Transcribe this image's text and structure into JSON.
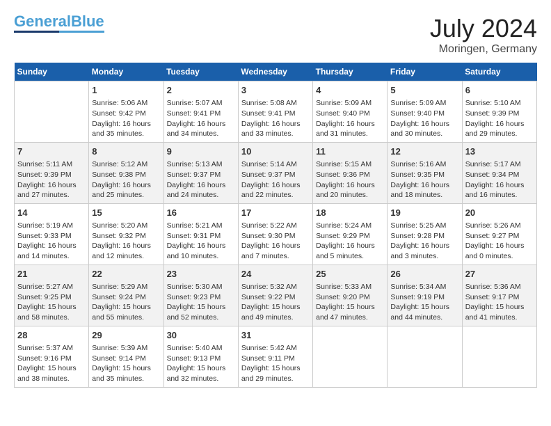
{
  "header": {
    "logo_line1": "General",
    "logo_line2": "Blue",
    "month_year": "July 2024",
    "location": "Moringen, Germany"
  },
  "days_of_week": [
    "Sunday",
    "Monday",
    "Tuesday",
    "Wednesday",
    "Thursday",
    "Friday",
    "Saturday"
  ],
  "weeks": [
    [
      {
        "day": "",
        "info": ""
      },
      {
        "day": "1",
        "info": "Sunrise: 5:06 AM\nSunset: 9:42 PM\nDaylight: 16 hours\nand 35 minutes."
      },
      {
        "day": "2",
        "info": "Sunrise: 5:07 AM\nSunset: 9:41 PM\nDaylight: 16 hours\nand 34 minutes."
      },
      {
        "day": "3",
        "info": "Sunrise: 5:08 AM\nSunset: 9:41 PM\nDaylight: 16 hours\nand 33 minutes."
      },
      {
        "day": "4",
        "info": "Sunrise: 5:09 AM\nSunset: 9:40 PM\nDaylight: 16 hours\nand 31 minutes."
      },
      {
        "day": "5",
        "info": "Sunrise: 5:09 AM\nSunset: 9:40 PM\nDaylight: 16 hours\nand 30 minutes."
      },
      {
        "day": "6",
        "info": "Sunrise: 5:10 AM\nSunset: 9:39 PM\nDaylight: 16 hours\nand 29 minutes."
      }
    ],
    [
      {
        "day": "7",
        "info": "Sunrise: 5:11 AM\nSunset: 9:39 PM\nDaylight: 16 hours\nand 27 minutes."
      },
      {
        "day": "8",
        "info": "Sunrise: 5:12 AM\nSunset: 9:38 PM\nDaylight: 16 hours\nand 25 minutes."
      },
      {
        "day": "9",
        "info": "Sunrise: 5:13 AM\nSunset: 9:37 PM\nDaylight: 16 hours\nand 24 minutes."
      },
      {
        "day": "10",
        "info": "Sunrise: 5:14 AM\nSunset: 9:37 PM\nDaylight: 16 hours\nand 22 minutes."
      },
      {
        "day": "11",
        "info": "Sunrise: 5:15 AM\nSunset: 9:36 PM\nDaylight: 16 hours\nand 20 minutes."
      },
      {
        "day": "12",
        "info": "Sunrise: 5:16 AM\nSunset: 9:35 PM\nDaylight: 16 hours\nand 18 minutes."
      },
      {
        "day": "13",
        "info": "Sunrise: 5:17 AM\nSunset: 9:34 PM\nDaylight: 16 hours\nand 16 minutes."
      }
    ],
    [
      {
        "day": "14",
        "info": "Sunrise: 5:19 AM\nSunset: 9:33 PM\nDaylight: 16 hours\nand 14 minutes."
      },
      {
        "day": "15",
        "info": "Sunrise: 5:20 AM\nSunset: 9:32 PM\nDaylight: 16 hours\nand 12 minutes."
      },
      {
        "day": "16",
        "info": "Sunrise: 5:21 AM\nSunset: 9:31 PM\nDaylight: 16 hours\nand 10 minutes."
      },
      {
        "day": "17",
        "info": "Sunrise: 5:22 AM\nSunset: 9:30 PM\nDaylight: 16 hours\nand 7 minutes."
      },
      {
        "day": "18",
        "info": "Sunrise: 5:24 AM\nSunset: 9:29 PM\nDaylight: 16 hours\nand 5 minutes."
      },
      {
        "day": "19",
        "info": "Sunrise: 5:25 AM\nSunset: 9:28 PM\nDaylight: 16 hours\nand 3 minutes."
      },
      {
        "day": "20",
        "info": "Sunrise: 5:26 AM\nSunset: 9:27 PM\nDaylight: 16 hours\nand 0 minutes."
      }
    ],
    [
      {
        "day": "21",
        "info": "Sunrise: 5:27 AM\nSunset: 9:25 PM\nDaylight: 15 hours\nand 58 minutes."
      },
      {
        "day": "22",
        "info": "Sunrise: 5:29 AM\nSunset: 9:24 PM\nDaylight: 15 hours\nand 55 minutes."
      },
      {
        "day": "23",
        "info": "Sunrise: 5:30 AM\nSunset: 9:23 PM\nDaylight: 15 hours\nand 52 minutes."
      },
      {
        "day": "24",
        "info": "Sunrise: 5:32 AM\nSunset: 9:22 PM\nDaylight: 15 hours\nand 49 minutes."
      },
      {
        "day": "25",
        "info": "Sunrise: 5:33 AM\nSunset: 9:20 PM\nDaylight: 15 hours\nand 47 minutes."
      },
      {
        "day": "26",
        "info": "Sunrise: 5:34 AM\nSunset: 9:19 PM\nDaylight: 15 hours\nand 44 minutes."
      },
      {
        "day": "27",
        "info": "Sunrise: 5:36 AM\nSunset: 9:17 PM\nDaylight: 15 hours\nand 41 minutes."
      }
    ],
    [
      {
        "day": "28",
        "info": "Sunrise: 5:37 AM\nSunset: 9:16 PM\nDaylight: 15 hours\nand 38 minutes."
      },
      {
        "day": "29",
        "info": "Sunrise: 5:39 AM\nSunset: 9:14 PM\nDaylight: 15 hours\nand 35 minutes."
      },
      {
        "day": "30",
        "info": "Sunrise: 5:40 AM\nSunset: 9:13 PM\nDaylight: 15 hours\nand 32 minutes."
      },
      {
        "day": "31",
        "info": "Sunrise: 5:42 AM\nSunset: 9:11 PM\nDaylight: 15 hours\nand 29 minutes."
      },
      {
        "day": "",
        "info": ""
      },
      {
        "day": "",
        "info": ""
      },
      {
        "day": "",
        "info": ""
      }
    ]
  ]
}
